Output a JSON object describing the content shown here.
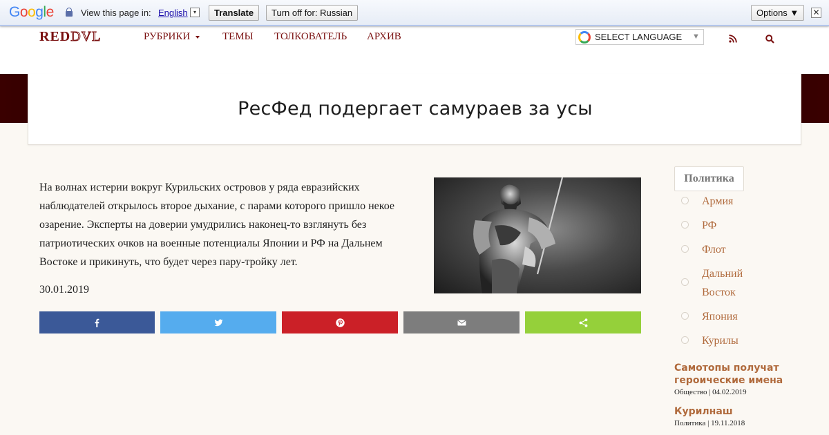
{
  "translate_bar": {
    "logo": [
      "G",
      "o",
      "o",
      "g",
      "l",
      "e"
    ],
    "view_text": "View this page in:",
    "language": "English",
    "dropdown_glyph": "▾",
    "translate_button": "Translate",
    "turn_off_button": "Turn off for: Russian",
    "options_button": "Options ▼",
    "close_glyph": "✕"
  },
  "header": {
    "logo_bold": "RED",
    "logo_thin": "DVL",
    "nav": [
      {
        "label": "РУБРИКИ"
      },
      {
        "label": "ТЕМЫ"
      },
      {
        "label": "ТОЛКОВАТЕЛЬ"
      },
      {
        "label": "АРХИВ"
      }
    ],
    "language_select": "SELECT LANGUAGE",
    "language_arrow": "▼",
    "icons": [
      "rss-icon",
      "search-icon"
    ]
  },
  "page": {
    "title": "РесФед подергает самураев за усы"
  },
  "article": {
    "text": "На волнах истерии вокруг Курильских островов у ряда евразийских наблюдателей открылось второе дыхание, с парами которого пришло некое озарение. Эксперты на доверии умудрились наконец-то взглянуть без патриотических очков на военные потенциалы Японии и РФ на Дальнем Востоке и прикинуть, что будет через пару-тройку лет.",
    "date": "30.01.2019",
    "image_alt": "samurai-image"
  },
  "share": [
    {
      "network": "facebook",
      "icon": "facebook-icon",
      "color": "#3b5998"
    },
    {
      "network": "twitter",
      "icon": "twitter-icon",
      "color": "#55acee"
    },
    {
      "network": "pinterest",
      "icon": "pinterest-icon",
      "color": "#cb2027"
    },
    {
      "network": "email",
      "icon": "email-icon",
      "color": "#7d7d7d"
    },
    {
      "network": "sharethis",
      "icon": "share-icon",
      "color": "#95d03a"
    }
  ],
  "sidebar": {
    "main_tag": "Политика",
    "tags": [
      "Армия",
      "РФ",
      "Флот",
      "Дальний Восток",
      "Япония",
      "Курилы"
    ],
    "posts": [
      {
        "title": "Самотопы получат героические имена",
        "meta": "Общество | 04.02.2019"
      },
      {
        "title": "Курилнаш",
        "meta": "Политика | 19.11.2018"
      }
    ]
  },
  "colors": {
    "accent": "#7a1010",
    "link": "#b06a3c",
    "hero": "#1a0000"
  }
}
